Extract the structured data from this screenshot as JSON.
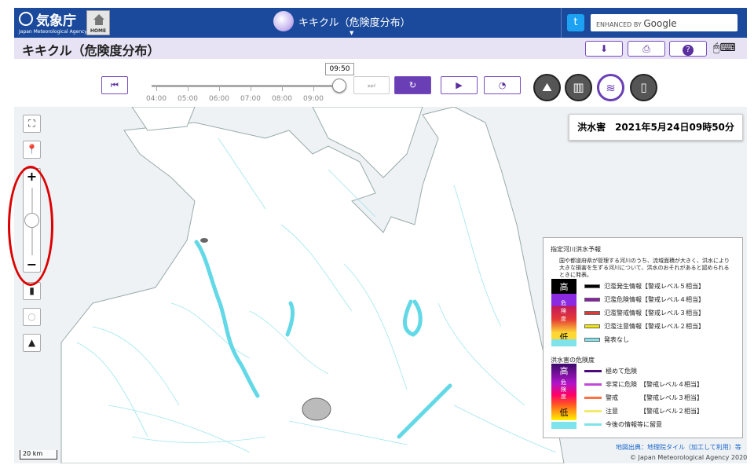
{
  "header": {
    "agency_name": "気象庁",
    "agency_name_en": "Japan Meteorological Agency",
    "home_label": "HOME",
    "app_title": "キキクル（危険度分布）",
    "search_enhanced": "ENHANCED BY",
    "search_brand": "Google"
  },
  "subbar": {
    "title": "キキクル（危険度分布）"
  },
  "timeline": {
    "current_time": "09:50",
    "ticks": [
      "04:00",
      "05:00",
      "06:00",
      "07:00",
      "08:00",
      "09:00"
    ],
    "position_fraction": 1.0
  },
  "map": {
    "datetime_label": "洪水害　2021年5月24日09時50分",
    "scale_label": "20 km",
    "credit_link": "地図出典：地理院タイル（加工して利用）等",
    "copyright": "© Japan Meteorological Agency 2020",
    "zoom_level_fraction": 0.45
  },
  "legend": {
    "section1_title": "指定河川洪水予報",
    "section1_note": "国や都道府県が管理する河川のうち、流域面積が大きく、洪水により大きな損害を生ずる河川について、洪水のおそれがあると認められるときに発表。",
    "scale_high": "高",
    "scale_mid": "危険度",
    "scale_low": "低",
    "section1_items": [
      {
        "label": "氾濫発生情報【警戒レベル５相当】",
        "color": "#000000"
      },
      {
        "label": "氾濫危険情報【警戒レベル４相当】",
        "color": "#8b1fa8"
      },
      {
        "label": "氾濫警戒情報【警戒レベル３相当】",
        "color": "#e53935"
      },
      {
        "label": "氾濫注意情報【警戒レベル２相当】",
        "color": "#f5e600"
      },
      {
        "label": "発表なし",
        "color": "#7fe3ec"
      }
    ],
    "section2_title": "洪水害の危険度",
    "section2_items": [
      {
        "label": "極めて危険",
        "color": "#4b0a7a"
      },
      {
        "label": "非常に危険　【警戒レベル４相当】",
        "color": "#c04ad9"
      },
      {
        "label": "警戒　　　　【警戒レベル３相当】",
        "color": "#ff7043"
      },
      {
        "label": "注意　　　　【警戒レベル２相当】",
        "color": "#f2ea6a"
      },
      {
        "label": "今後の情報等に留意",
        "color": "#7fe3ec"
      }
    ]
  },
  "colors": {
    "header_bg": "#1b4a9c",
    "accent": "#6a3fb6",
    "river": "#7fe3ec"
  }
}
